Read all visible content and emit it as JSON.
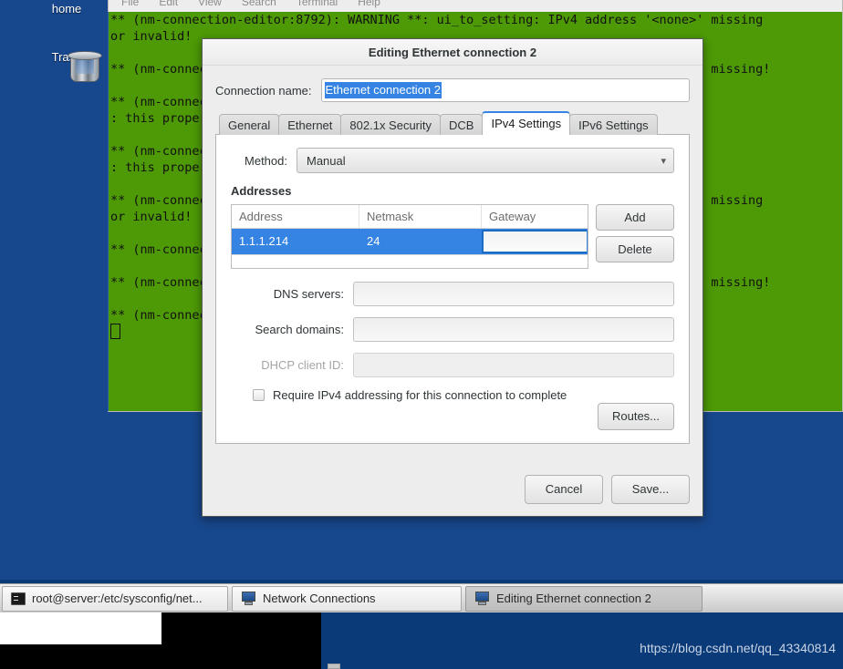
{
  "desktop": {
    "icons": [
      {
        "name": "home",
        "label": "home"
      },
      {
        "name": "trash",
        "label": "Trash"
      }
    ],
    "watermark": "https://blog.csdn.net/qq_43340814"
  },
  "terminal": {
    "menu": [
      "File",
      "Edit",
      "View",
      "Search",
      "Terminal",
      "Help"
    ],
    "lines": [
      "** (nm-connection-editor:8792): WARNING **: ui_to_setting: IPv4 address '<none>' missing",
      "or invalid!",
      "",
      "** (nm-connection-editor:8792): WARNING **: ui_to_setting: IPv4 address '<none>' missing!",
      "",
      "** (nm-connection-editor:8792): WARNING **: nm_setting_verify: ipv4.addresses",
      ": this property is invalid",
      "",
      "** (nm-connection-editor:8792): WARNING **: nm_setting_verify: ipv4.addresses",
      ": this property is invalid",
      "",
      "** (nm-connection-editor:8792): WARNING **: ui_to_setting: IPv4 address '<none>' missing",
      "or invalid!",
      "",
      "** (nm-connection-editor:8792): WARNING **: ui_to_setting: IPv4 addresses",
      "",
      "** (nm-connection-editor:8792): WARNING **: ui_to_setting: IPv4 address '<none>' missing!",
      "",
      "** (nm-connection-editor:8792): WARNING **: ui_to_setting: IPv4 addresses"
    ]
  },
  "dialog": {
    "title": "Editing Ethernet connection 2",
    "connection_name_label": "Connection name:",
    "connection_name_value": "Ethernet connection 2",
    "tabs": [
      {
        "label": "General",
        "active": false
      },
      {
        "label": "Ethernet",
        "active": false
      },
      {
        "label": "802.1x Security",
        "active": false
      },
      {
        "label": "DCB",
        "active": false
      },
      {
        "label": "IPv4 Settings",
        "active": true
      },
      {
        "label": "IPv6 Settings",
        "active": false
      }
    ],
    "ipv4": {
      "method_label": "Method:",
      "method_value": "Manual",
      "addresses_title": "Addresses",
      "columns": [
        "Address",
        "Netmask",
        "Gateway"
      ],
      "rows": [
        {
          "address": "1.1.1.214",
          "netmask": "24",
          "gateway": ""
        }
      ],
      "add_label": "Add",
      "delete_label": "Delete",
      "dns_label": "DNS servers:",
      "dns_value": "",
      "search_domains_label": "Search domains:",
      "search_domains_value": "",
      "dhcp_client_id_label": "DHCP client ID:",
      "dhcp_client_id_value": "",
      "require_ipv4_label": "Require IPv4 addressing for this connection to complete",
      "require_ipv4_checked": false,
      "routes_label": "Routes..."
    },
    "cancel_label": "Cancel",
    "save_label": "Save..."
  },
  "taskbar": {
    "items": [
      {
        "label": "root@server:/etc/sysconfig/net...",
        "icon": "terminal-icon",
        "active": false
      },
      {
        "label": "Network Connections",
        "icon": "network-icon",
        "active": false
      },
      {
        "label": "Editing Ethernet connection 2",
        "icon": "network-icon",
        "active": true
      }
    ]
  },
  "colors": {
    "accent": "#3584e4",
    "terminal_bg": "#4e9a06",
    "desktop_bg": "#17478c"
  }
}
